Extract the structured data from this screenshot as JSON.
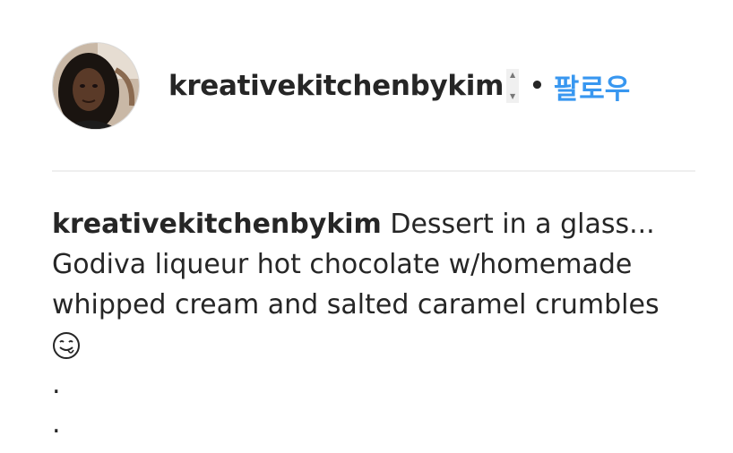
{
  "post": {
    "username": "kreativekitchenbykim",
    "follow_label": "팔로우",
    "separator": "•",
    "stepper_up": "▲",
    "stepper_down": "▼"
  },
  "caption": {
    "author": "kreativekitchenbykim",
    "text": "Dessert in a glass... Godiva liqueur hot chocolate w/homemade whipped cream and salted caramel crumbles",
    "emoji": "yum-face-icon",
    "dots": [
      ".",
      "."
    ]
  },
  "colors": {
    "follow": "#3897f0",
    "text": "#262626",
    "divider": "#efefef"
  }
}
